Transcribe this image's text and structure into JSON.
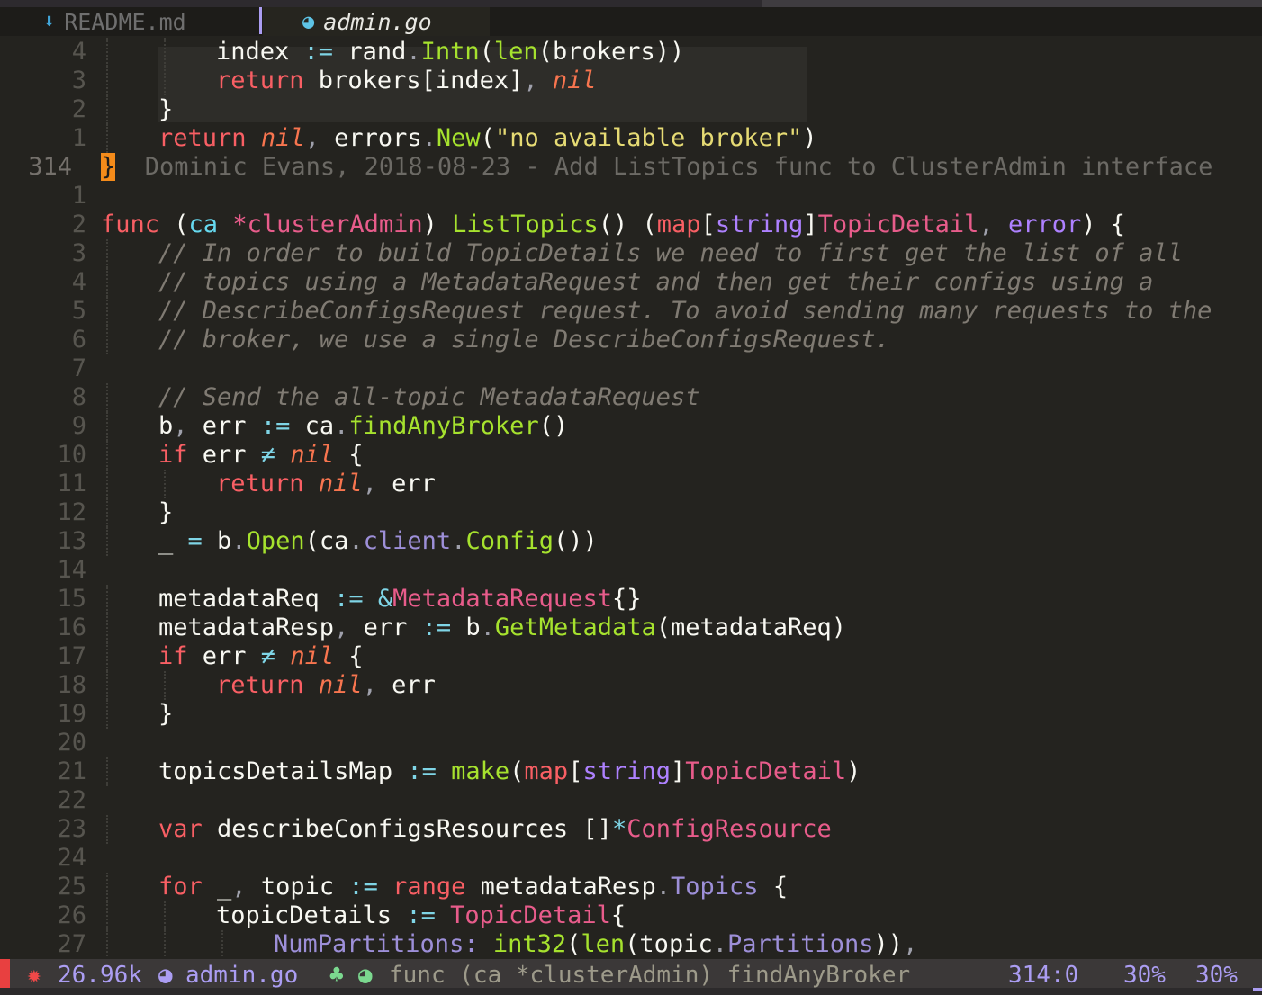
{
  "tabs": [
    {
      "label": "README.md",
      "icon": "download-arrow-icon",
      "active": false
    },
    {
      "label": "admin.go",
      "icon": "gopher-icon",
      "active": true
    }
  ],
  "blame": {
    "line_number": "314",
    "text": "Dominic Evans, 2018-08-23 - Add ListTopics func to ClusterAdmin interface"
  },
  "gutter": {
    "above": [
      "4",
      "3",
      "2",
      "1"
    ],
    "below": [
      "1",
      "2",
      "3",
      "4",
      "5",
      "6",
      "7",
      "8",
      "9",
      "10",
      "11",
      "12",
      "13",
      "14",
      "15",
      "16",
      "17",
      "18",
      "19",
      "20",
      "21",
      "22",
      "23",
      "24",
      "25",
      "26",
      "27"
    ]
  },
  "code_lines": {
    "a4": [
      [
        "br",
        "index "
      ],
      [
        "op",
        ":="
      ],
      [
        "br",
        " rand"
      ],
      [
        "pu",
        "."
      ],
      [
        "fn",
        "Intn"
      ],
      [
        "br",
        "("
      ],
      [
        "fn",
        "len"
      ],
      [
        "br",
        "(brokers))"
      ]
    ],
    "a3": [
      [
        "kw",
        "return"
      ],
      [
        "br",
        " brokers[index]"
      ],
      [
        "pu",
        ", "
      ],
      [
        "nl",
        "nil"
      ]
    ],
    "a2": [
      [
        "br",
        "}"
      ]
    ],
    "a1": [
      [
        "kw",
        "return"
      ],
      [
        "br",
        " "
      ],
      [
        "nl",
        "nil"
      ],
      [
        "pu",
        ", "
      ],
      [
        "br",
        "errors"
      ],
      [
        "pu",
        "."
      ],
      [
        "fn",
        "New"
      ],
      [
        "br",
        "("
      ],
      [
        "st",
        "\"no available broker\""
      ],
      [
        "br",
        ")"
      ]
    ],
    "b1": [],
    "b2": [
      [
        "kw",
        "func"
      ],
      [
        "br",
        " ("
      ],
      [
        "pm",
        "ca"
      ],
      [
        "br",
        " "
      ],
      [
        "ty",
        "*clusterAdmin"
      ],
      [
        "br",
        ") "
      ],
      [
        "fn",
        "ListTopics"
      ],
      [
        "br",
        "() ("
      ],
      [
        "kw",
        "map"
      ],
      [
        "br",
        "["
      ],
      [
        "bi",
        "string"
      ],
      [
        "br",
        "]"
      ],
      [
        "ty",
        "TopicDetail"
      ],
      [
        "pu",
        ", "
      ],
      [
        "bi",
        "error"
      ],
      [
        "br",
        ") {"
      ]
    ],
    "b3": [
      [
        "cm",
        "// In order to build TopicDetails we need to first get the list of all"
      ]
    ],
    "b4": [
      [
        "cm",
        "// topics using a MetadataRequest and then get their configs using a"
      ]
    ],
    "b5": [
      [
        "cm",
        "// DescribeConfigsRequest request. To avoid sending many requests to the"
      ]
    ],
    "b6": [
      [
        "cm",
        "// broker, we use a single DescribeConfigsRequest."
      ]
    ],
    "b7": [],
    "b8": [
      [
        "cm",
        "// Send the all-topic MetadataRequest"
      ]
    ],
    "b9": [
      [
        "br",
        "b"
      ],
      [
        "pu",
        ", "
      ],
      [
        "br",
        "err "
      ],
      [
        "op",
        ":="
      ],
      [
        "br",
        " ca"
      ],
      [
        "pu",
        "."
      ],
      [
        "fn",
        "findAnyBroker"
      ],
      [
        "br",
        "()"
      ]
    ],
    "b10": [
      [
        "kw",
        "if"
      ],
      [
        "br",
        " err "
      ],
      [
        "op",
        "≠"
      ],
      [
        "br",
        " "
      ],
      [
        "nl",
        "nil"
      ],
      [
        "br",
        " {"
      ]
    ],
    "b11": [
      [
        "kw",
        "return"
      ],
      [
        "br",
        " "
      ],
      [
        "nl",
        "nil"
      ],
      [
        "pu",
        ", "
      ],
      [
        "br",
        "err"
      ]
    ],
    "b12": [
      [
        "br",
        "}"
      ]
    ],
    "b13": [
      [
        "br",
        "_ "
      ],
      [
        "op",
        "="
      ],
      [
        "br",
        " b"
      ],
      [
        "pu",
        "."
      ],
      [
        "fn",
        "Open"
      ],
      [
        "br",
        "(ca"
      ],
      [
        "pu",
        "."
      ],
      [
        "fd",
        "client"
      ],
      [
        "pu",
        "."
      ],
      [
        "fn",
        "Config"
      ],
      [
        "br",
        "())"
      ]
    ],
    "b14": [],
    "b15": [
      [
        "br",
        "metadataReq "
      ],
      [
        "op",
        ":="
      ],
      [
        "br",
        " "
      ],
      [
        "op",
        "&"
      ],
      [
        "ty",
        "MetadataRequest"
      ],
      [
        "br",
        "{}"
      ]
    ],
    "b16": [
      [
        "br",
        "metadataResp"
      ],
      [
        "pu",
        ", "
      ],
      [
        "br",
        "err "
      ],
      [
        "op",
        ":="
      ],
      [
        "br",
        " b"
      ],
      [
        "pu",
        "."
      ],
      [
        "fn",
        "GetMetadata"
      ],
      [
        "br",
        "(metadataReq)"
      ]
    ],
    "b17": [
      [
        "kw",
        "if"
      ],
      [
        "br",
        " err "
      ],
      [
        "op",
        "≠"
      ],
      [
        "br",
        " "
      ],
      [
        "nl",
        "nil"
      ],
      [
        "br",
        " {"
      ]
    ],
    "b18": [
      [
        "kw",
        "return"
      ],
      [
        "br",
        " "
      ],
      [
        "nl",
        "nil"
      ],
      [
        "pu",
        ", "
      ],
      [
        "br",
        "err"
      ]
    ],
    "b19": [
      [
        "br",
        "}"
      ]
    ],
    "b20": [],
    "b21": [
      [
        "br",
        "topicsDetailsMap "
      ],
      [
        "op",
        ":="
      ],
      [
        "br",
        " "
      ],
      [
        "fn",
        "make"
      ],
      [
        "br",
        "("
      ],
      [
        "kw",
        "map"
      ],
      [
        "br",
        "["
      ],
      [
        "bi",
        "string"
      ],
      [
        "br",
        "]"
      ],
      [
        "ty",
        "TopicDetail"
      ],
      [
        "br",
        ")"
      ]
    ],
    "b22": [],
    "b23": [
      [
        "kw",
        "var"
      ],
      [
        "br",
        " describeConfigsResources []"
      ],
      [
        "op",
        "*"
      ],
      [
        "ty",
        "ConfigResource"
      ]
    ],
    "b24": [],
    "b25": [
      [
        "kw",
        "for"
      ],
      [
        "br",
        " _"
      ],
      [
        "pu",
        ", "
      ],
      [
        "br",
        "topic "
      ],
      [
        "op",
        ":="
      ],
      [
        "br",
        " "
      ],
      [
        "kw",
        "range"
      ],
      [
        "br",
        " metadataResp"
      ],
      [
        "pu",
        "."
      ],
      [
        "fd",
        "Topics"
      ],
      [
        "br",
        " {"
      ]
    ],
    "b26": [
      [
        "br",
        "topicDetails "
      ],
      [
        "op",
        ":="
      ],
      [
        "br",
        " "
      ],
      [
        "ty",
        "TopicDetail"
      ],
      [
        "br",
        "{"
      ]
    ],
    "b27": [
      [
        "fd",
        "NumPartitions:"
      ],
      [
        "br",
        " "
      ],
      [
        "fn",
        "int32"
      ],
      [
        "br",
        "("
      ],
      [
        "fn",
        "len"
      ],
      [
        "br",
        "(topic"
      ],
      [
        "pu",
        "."
      ],
      [
        "fd",
        "Partitions"
      ],
      [
        "br",
        "))"
      ],
      [
        "pu",
        ","
      ]
    ]
  },
  "status": {
    "size": "26.96k",
    "file": "admin.go",
    "func": "func (ca *clusterAdmin) findAnyBroker",
    "position": "314:0",
    "percent1": "30%",
    "percent2": "30%",
    "icons": [
      "bug-icon",
      "gopher-icon",
      "tree-icon",
      "gopher-icon"
    ]
  },
  "colors": {
    "keyword": "#f95f64",
    "function": "#a6e22e",
    "type": "#e85c8b",
    "builtin": "#ae81ff",
    "string": "#e6db74",
    "comment": "#807b73",
    "cursor": "#f48b1a",
    "accent": "#ab9df2"
  }
}
